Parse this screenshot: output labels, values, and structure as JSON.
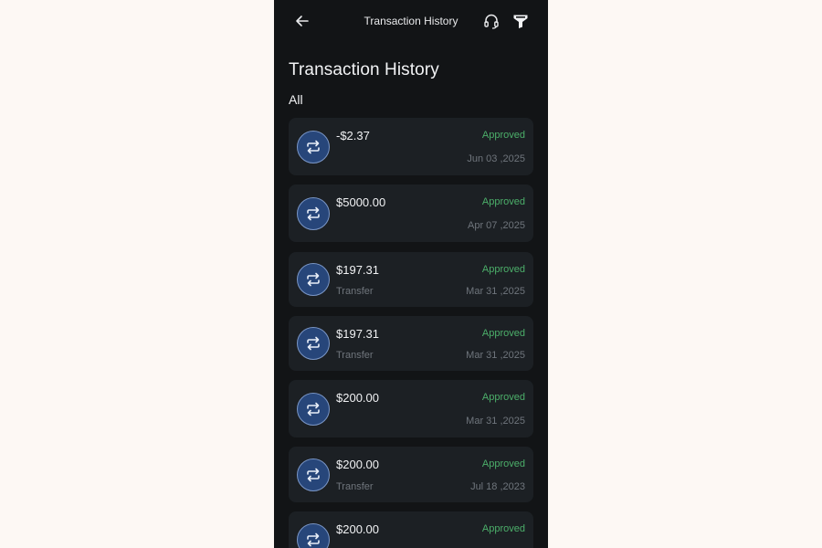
{
  "header": {
    "title": "Transaction History"
  },
  "page": {
    "heading": "Transaction History",
    "filter": "All"
  },
  "transactions": [
    {
      "amount": "-$2.37",
      "description": "",
      "status": "Approved",
      "date": "Jun 03 ,2025"
    },
    {
      "amount": "$5000.00",
      "description": "",
      "status": "Approved",
      "date": "Apr 07 ,2025"
    },
    {
      "amount": "$197.31",
      "description": "Transfer",
      "status": "Approved",
      "date": "Mar 31 ,2025"
    },
    {
      "amount": "$197.31",
      "description": "Transfer",
      "status": "Approved",
      "date": "Mar 31 ,2025"
    },
    {
      "amount": "$200.00",
      "description": "",
      "status": "Approved",
      "date": "Mar 31 ,2025"
    },
    {
      "amount": "$200.00",
      "description": "Transfer",
      "status": "Approved",
      "date": "Jul 18 ,2023"
    },
    {
      "amount": "$200.00",
      "description": "",
      "status": "Approved",
      "date": ""
    }
  ],
  "icons": {
    "back": "arrow-left-icon",
    "support": "headset-icon",
    "filter": "filter-icon",
    "transaction": "transfer-arrows-icon"
  },
  "colors": {
    "status_approved": "#4caf6a",
    "icon_circle": "#27467a"
  }
}
